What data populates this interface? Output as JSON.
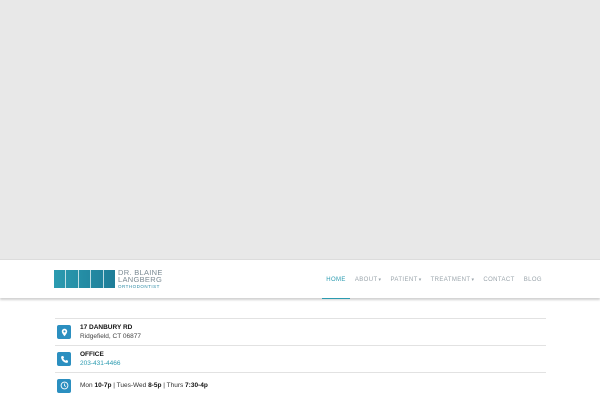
{
  "logo": {
    "line1": "DR. BLAINE",
    "line2": "LANGBERG",
    "line3": "ORTHODONTIST"
  },
  "nav": {
    "items": [
      {
        "label": "HOME",
        "active": true
      },
      {
        "label": "ABOUT",
        "caret": "▾"
      },
      {
        "label": "PATIENT",
        "caret": "▾"
      },
      {
        "label": "TREATMENT",
        "caret": "▾"
      },
      {
        "label": "CONTACT"
      },
      {
        "label": "BLOG"
      }
    ]
  },
  "info": {
    "address": {
      "line1": "17 DANBURY RD",
      "line2": "Ridgefield, CT 06877",
      "icon": "map-pin-icon"
    },
    "phone": {
      "title": "OFFICE",
      "number": "203-431-4466",
      "icon": "phone-icon"
    },
    "hours": {
      "d1": "Mon ",
      "t1": "10-7p",
      "sep1": " | Tues-Wed ",
      "t2": "8-5p",
      "sep2": " |  Thurs ",
      "t3": "7:30-4p",
      "icon": "clock-icon"
    }
  },
  "colors": {
    "accent": "#2b9bb0",
    "icon_bg": "#2b8fc0",
    "hero": "#e8e8e8"
  }
}
